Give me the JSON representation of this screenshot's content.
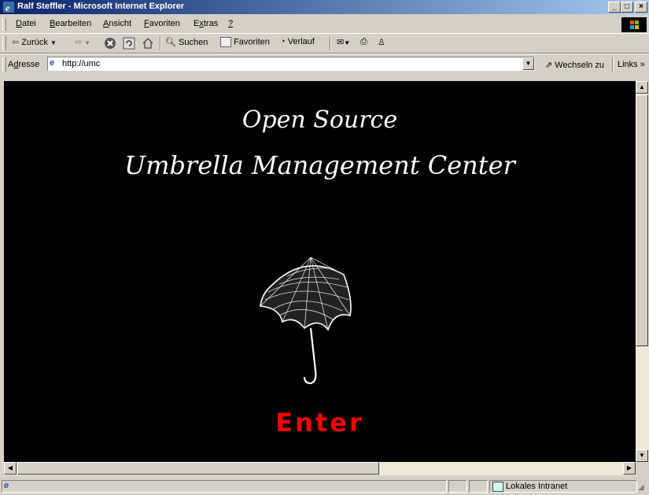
{
  "window": {
    "title": "Ralf Steffler - Microsoft Internet Explorer",
    "controls": [
      "_",
      "□",
      "×"
    ]
  },
  "menu": {
    "items": [
      {
        "key": "D",
        "rest": "atei"
      },
      {
        "key": "B",
        "rest": "earbeiten"
      },
      {
        "key": "A",
        "rest": "nsicht"
      },
      {
        "key": "F",
        "rest": "avoriten"
      },
      {
        "pre": "E",
        "key": "x",
        "rest": "tras"
      },
      {
        "key": "?",
        "rest": ""
      }
    ]
  },
  "toolbar": {
    "back_label": "Zurück",
    "search_label": "Suchen",
    "favorites_label": "Favoriten",
    "history_label": "Verlauf"
  },
  "address": {
    "label_pre": "A",
    "label_key": "d",
    "label_post": "resse",
    "url": "http://umc",
    "go_label": "Wechseln zu",
    "links_label": "Links"
  },
  "page": {
    "title_line1": "Open Source",
    "title_line2": "Umbrella Management Center",
    "enter_label": "Enter"
  },
  "status": {
    "zone_label": "Lokales Intranet"
  }
}
